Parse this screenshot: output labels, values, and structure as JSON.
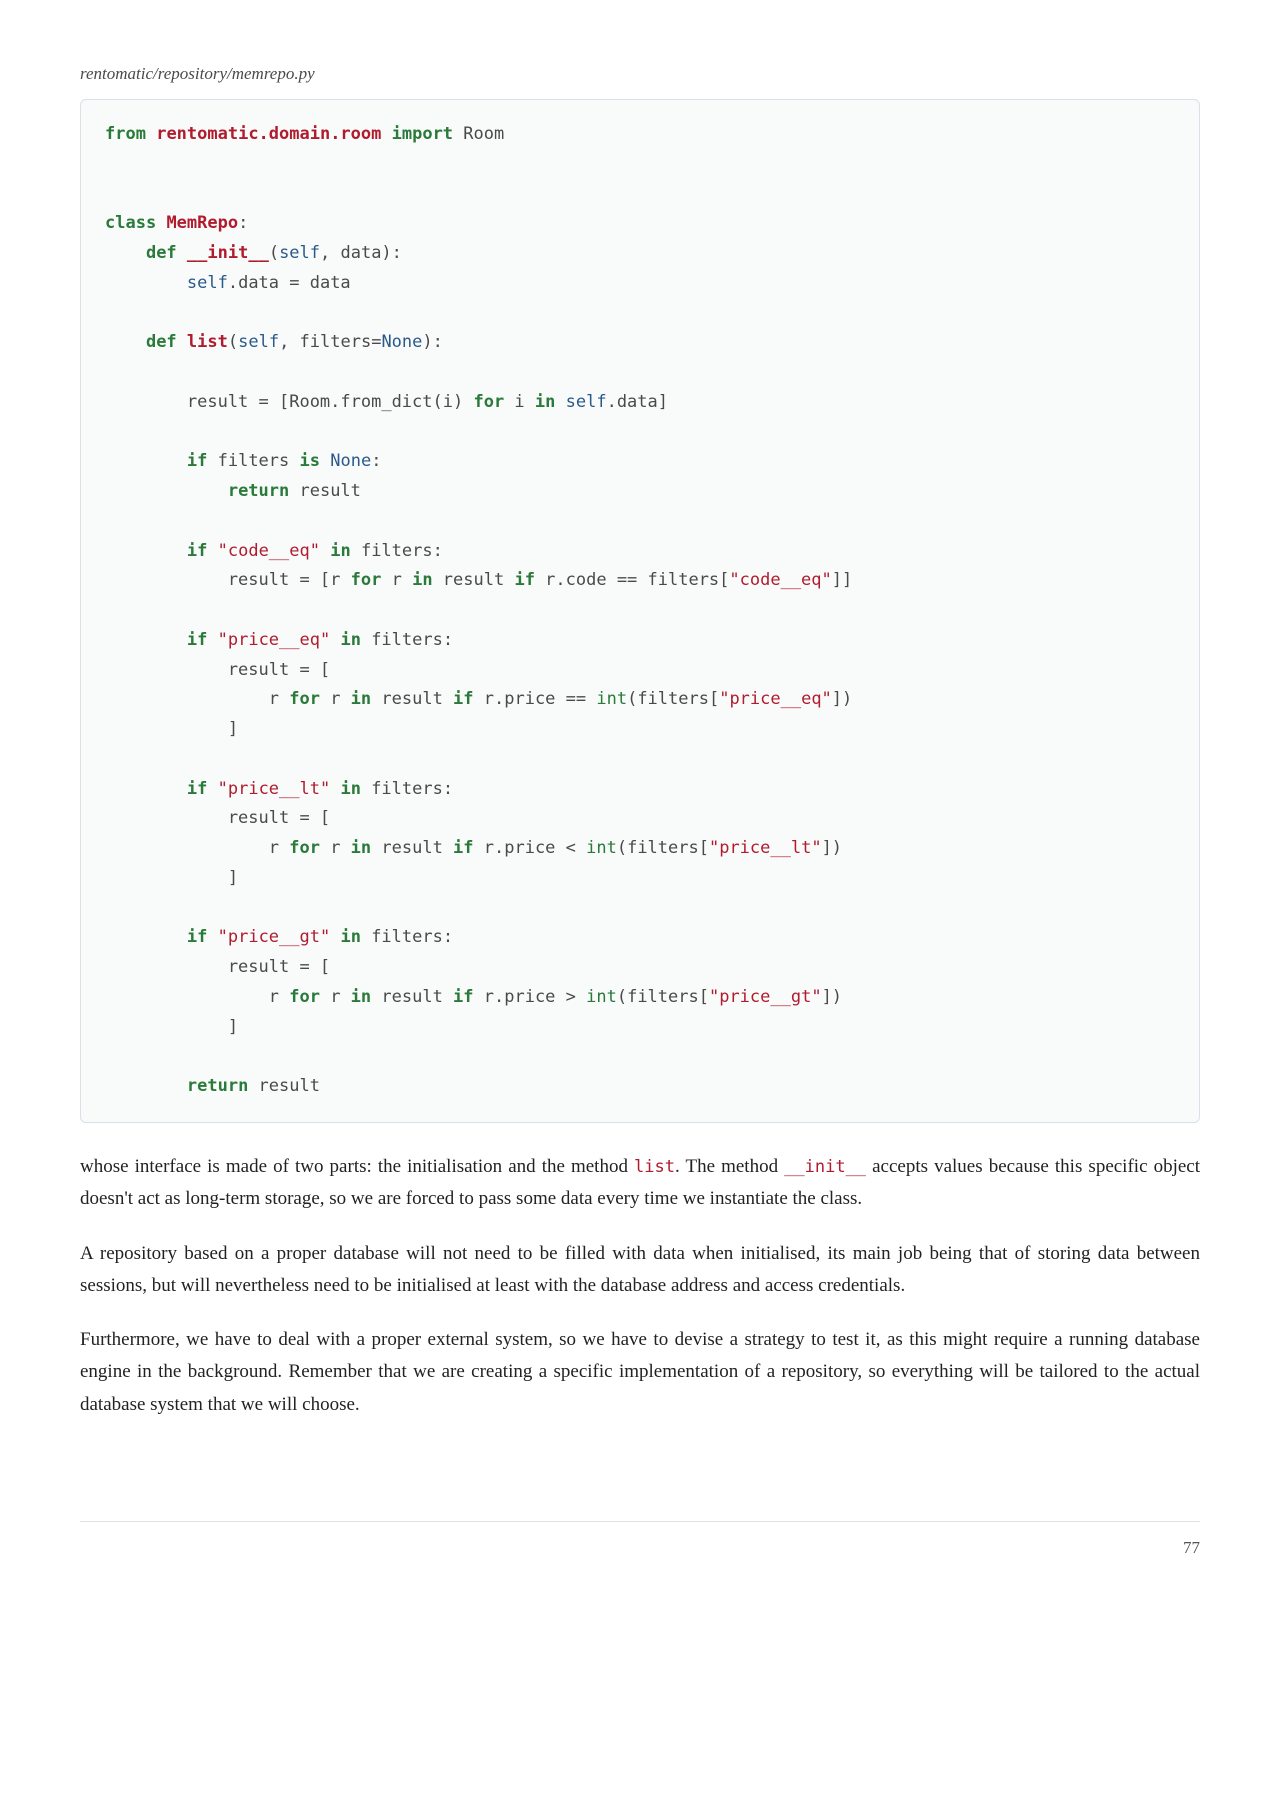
{
  "file_path": "rentomatic/repository/memrepo.py",
  "code": {
    "l1_from": "from",
    "l1_mod": "rentomatic.domain.room",
    "l1_import": "import",
    "l1_room": "Room",
    "l2_class": "class",
    "l2_name": "MemRepo",
    "l3_def": "def",
    "l3_init": "__init__",
    "l3_self": "self",
    "l3_data": ", data):",
    "l4_self": "self",
    "l4_rest": ".data = data",
    "l5_def": "def",
    "l5_list": "list",
    "l5_self": "self",
    "l5_filters": ", filters=",
    "l5_none": "None",
    "l5_close": "):",
    "l6_pre": "        result = [Room.from_dict(i) ",
    "l6_for": "for",
    "l6_mid": " i ",
    "l6_in": "in",
    "l6_self": " self",
    "l6_rest": ".data]",
    "l7_if": "if",
    "l7_mid": " filters ",
    "l7_is": "is",
    "l7_sp": " ",
    "l7_none": "None",
    "l7_colon": ":",
    "l8_return": "return",
    "l8_result": " result",
    "l9_if": "if",
    "l9_sp": " ",
    "l9_str": "\"code__eq\"",
    "l9_sp2": " ",
    "l9_in": "in",
    "l9_rest": " filters:",
    "l10_pre": "            result = [r ",
    "l10_for": "for",
    "l10_mid": " r ",
    "l10_in": "in",
    "l10_mid2": " result ",
    "l10_if": "if",
    "l10_mid3": " r.code == filters[",
    "l10_str": "\"code__eq\"",
    "l10_close": "]]",
    "l11_if": "if",
    "l11_sp": " ",
    "l11_str": "\"price__eq\"",
    "l11_sp2": " ",
    "l11_in": "in",
    "l11_rest": " filters:",
    "l12": "            result = [",
    "l13_pre": "                r ",
    "l13_for": "for",
    "l13_mid": " r ",
    "l13_in": "in",
    "l13_mid2": " result ",
    "l13_if": "if",
    "l13_mid3": " r.price == ",
    "l13_int": "int",
    "l13_open": "(filters[",
    "l13_str": "\"price__eq\"",
    "l13_close": "])",
    "l14": "            ]",
    "l15_if": "if",
    "l15_sp": " ",
    "l15_str": "\"price__lt\"",
    "l15_sp2": " ",
    "l15_in": "in",
    "l15_rest": " filters:",
    "l16": "            result = [",
    "l17_pre": "                r ",
    "l17_for": "for",
    "l17_mid": " r ",
    "l17_in": "in",
    "l17_mid2": " result ",
    "l17_if": "if",
    "l17_mid3": " r.price < ",
    "l17_int": "int",
    "l17_open": "(filters[",
    "l17_str": "\"price__lt\"",
    "l17_close": "])",
    "l18": "            ]",
    "l19_if": "if",
    "l19_sp": " ",
    "l19_str": "\"price__gt\"",
    "l19_sp2": " ",
    "l19_in": "in",
    "l19_rest": " filters:",
    "l20": "            result = [",
    "l21_pre": "                r ",
    "l21_for": "for",
    "l21_mid": " r ",
    "l21_in": "in",
    "l21_mid2": " result ",
    "l21_if": "if",
    "l21_mid3": " r.price > ",
    "l21_int": "int",
    "l21_open": "(filters[",
    "l21_str": "\"price__gt\"",
    "l21_close": "])",
    "l22": "            ]",
    "l23_return": "return",
    "l23_result": " result"
  },
  "para1": {
    "t1": "whose interface is made of two parts: the initialisation and the method ",
    "c1": "list",
    "t2": ". The method ",
    "c2": "__init__",
    "t3": " accepts values because this specific object doesn't act as long-term storage, so we are forced to pass some data every time we instantiate the class."
  },
  "para2": "A repository based on a proper database will not need to be filled with data when initialised, its main job being that of storing data between sessions, but will nevertheless need to be initialised at least with the database address and access credentials.",
  "para3": "Furthermore, we have to deal with a proper external system, so we have to devise a strategy to test it, as this might require a running database engine in the background. Remember that we are creating a specific implementation of a repository, so everything will be tailored to the actual database system that we will choose.",
  "page_number": "77"
}
